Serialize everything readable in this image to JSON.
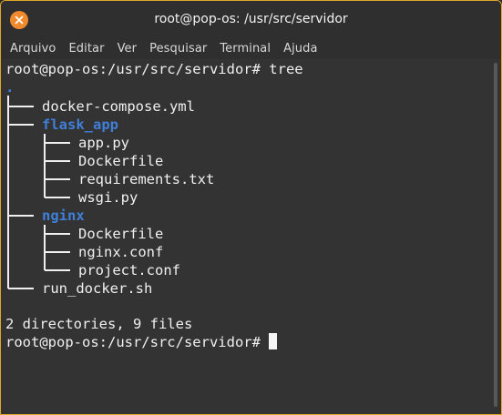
{
  "window": {
    "title": "root@pop-os: /usr/src/servidor"
  },
  "menu": [
    "Arquivo",
    "Editar",
    "Ver",
    "Pesquisar",
    "Terminal",
    "Ajuda"
  ],
  "terminal": {
    "prompt_command": "root@pop-os:/usr/src/servidor# tree",
    "root": ".",
    "entries": [
      {
        "name": "docker-compose.yml",
        "is_dir": false
      },
      {
        "name": "flask_app",
        "is_dir": true
      },
      {
        "name": "app.py",
        "is_dir": false
      },
      {
        "name": "Dockerfile",
        "is_dir": false
      },
      {
        "name": "requirements.txt",
        "is_dir": false
      },
      {
        "name": "wsgi.py",
        "is_dir": false
      },
      {
        "name": "nginx",
        "is_dir": true
      },
      {
        "name": "Dockerfile",
        "is_dir": false
      },
      {
        "name": "nginx.conf",
        "is_dir": false
      },
      {
        "name": "project.conf",
        "is_dir": false
      },
      {
        "name": "run_docker.sh",
        "is_dir": false
      }
    ],
    "summary": "2 directories, 9 files",
    "prompt": "root@pop-os:/usr/src/servidor# "
  },
  "colors": {
    "directory": "#3f7fd8",
    "close_button": "#f08a2c",
    "border": "#e0a72a"
  }
}
